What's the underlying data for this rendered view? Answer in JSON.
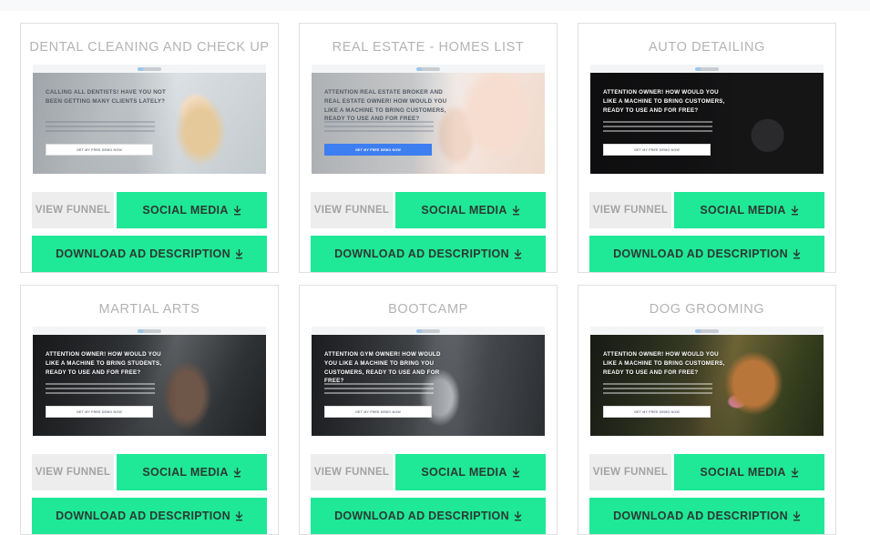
{
  "page": {
    "background_color": "#ffffff",
    "top_strip_color": "#f7f9fb",
    "accent_green": "#1fe896",
    "muted_gray": "#ededed",
    "title_color": "#b3b3b3"
  },
  "buttons": {
    "view_funnel_label": "VIEW FUNNEL",
    "social_media_label": "SOCIAL MEDIA",
    "download_ad_label": "DOWNLOAD AD DESCRIPTION",
    "download_icon": "download-icon"
  },
  "cards": [
    {
      "title": "DENTAL CLEANING AND CHECK UP",
      "thumbnail": {
        "headline": "CALLING ALL DENTISTS! HAVE YOU NOT BEEN GETTING MANY CLIENTS LATELY?",
        "cta_label": "GET MY FREE DEMO NOW",
        "cta_style": "white",
        "theme": "light",
        "scene": "dentist-chair-patient"
      }
    },
    {
      "title": "REAL ESTATE - HOMES LIST",
      "thumbnail": {
        "headline": "ATTENTION REAL ESTATE BROKER AND REAL ESTATE OWNER! HOW WOULD YOU LIKE A MACHINE TO BRING CUSTOMERS, READY TO USE AND FOR FREE?",
        "cta_label": "GET MY FREE DEMO NOW",
        "cta_style": "blue",
        "theme": "light",
        "scene": "hand-holding-house-keys"
      }
    },
    {
      "title": "AUTO DETAILING",
      "thumbnail": {
        "headline": "ATTENTION OWNER! HOW WOULD YOU LIKE A MACHINE TO BRING CUSTOMERS, READY TO USE AND FOR FREE?",
        "cta_label": "GET MY FREE DEMO NOW",
        "cta_style": "white",
        "theme": "dark",
        "scene": "black-sports-car-wheel"
      }
    },
    {
      "title": "MARTIAL ARTS",
      "thumbnail": {
        "headline": "ATTENTION OWNER! HOW WOULD YOU LIKE A MACHINE TO BRING STUDENTS, READY TO USE AND FOR FREE?",
        "cta_label": "GET MY FREE DEMO NOW",
        "cta_style": "white",
        "theme": "dark",
        "scene": "woman-training-gym"
      }
    },
    {
      "title": "BOOTCAMP",
      "thumbnail": {
        "headline": "ATTENTION GYM OWNER! HOW WOULD YOU LIKE A MACHINE TO BRING YOU CUSTOMERS, READY TO USE AND FOR FREE?",
        "cta_label": "GET MY FREE DEMO NOW",
        "cta_style": "white",
        "theme": "dark",
        "scene": "crossfit-gym-class"
      }
    },
    {
      "title": "DOG GROOMING",
      "thumbnail": {
        "headline": "ATTENTION OWNER! HOW WOULD YOU LIKE A MACHINE TO BRING CUSTOMERS, READY TO USE AND FOR FREE?",
        "cta_label": "GET MY FREE DEMO NOW",
        "cta_style": "white",
        "theme": "dark",
        "scene": "golden-retriever-outdoors"
      }
    }
  ]
}
